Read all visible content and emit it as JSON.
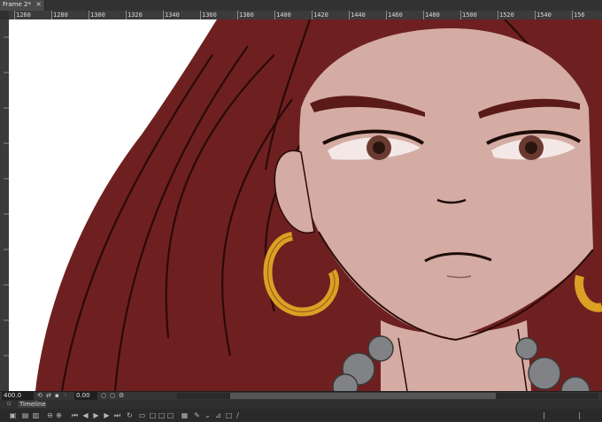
{
  "document_tab": {
    "title": "Frame 2*",
    "close_glyph": "×"
  },
  "ruler": {
    "labels": [
      "1260",
      "1280",
      "1300",
      "1320",
      "1340",
      "1360",
      "1380",
      "1400",
      "1420",
      "1440",
      "1460",
      "1480",
      "1500",
      "1520",
      "1540",
      "156"
    ]
  },
  "status": {
    "zoom_value": "400.0",
    "rotation_value": "0.00"
  },
  "timeline": {
    "tab_label": "Timeline"
  },
  "colors": {
    "hair": "#6e2020",
    "hair_dark": "#3a1010",
    "skin": "#d4aca3",
    "line": "#1e0c08",
    "earring": "#dba024",
    "necklace": "#808285",
    "background": "#ffffff"
  },
  "icons": {
    "statusbar": [
      "rotate-icon",
      "flip-icon",
      "lock-icon",
      "reset-icon"
    ],
    "timeline_tools": [
      "onion-skin-icon",
      "frame-icon",
      "zoom-out-icon",
      "zoom-in-icon",
      "first-frame-icon",
      "prev-frame-icon",
      "play-icon",
      "next-frame-icon",
      "last-frame-icon",
      "loop-icon",
      "add-keyframe-icon",
      "copy-icon",
      "paste-icon",
      "delete-icon",
      "settings-icon",
      "brush-icon",
      "brush-settings-icon",
      "dropper-icon",
      "pen-icon"
    ]
  }
}
